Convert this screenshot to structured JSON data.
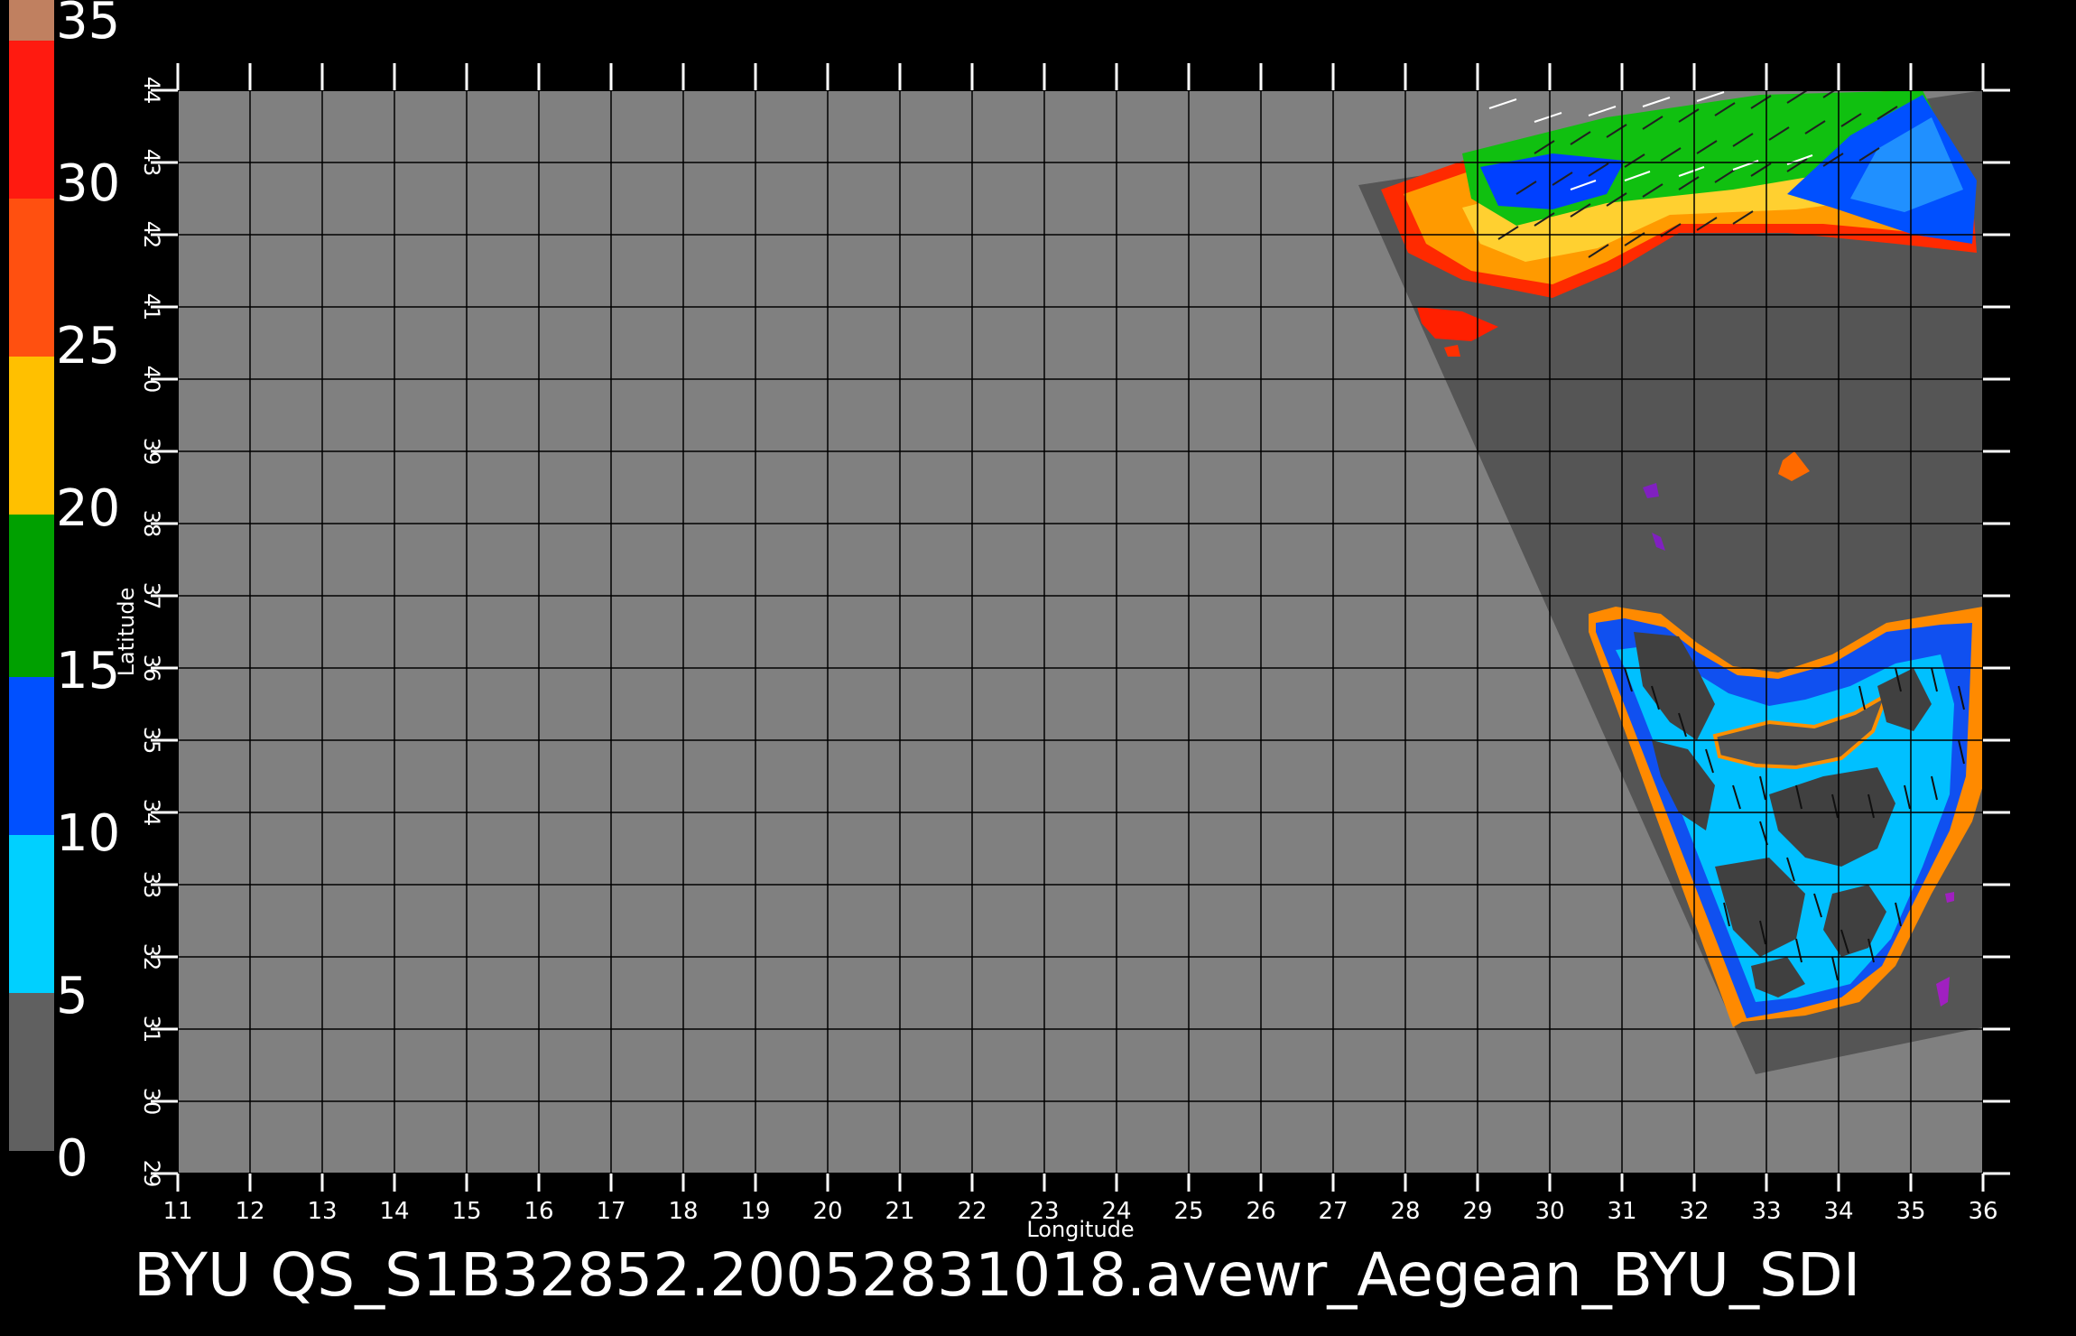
{
  "colorbar": {
    "labels": [
      "35",
      "30",
      "25",
      "20",
      "15",
      "10",
      "5",
      "0"
    ],
    "colors": {
      "top": "#c08060",
      "red": "#ff0000",
      "orange_red": "#ff3300",
      "orange": "#ff8000",
      "yellow_orange": "#ffc000",
      "yellow": "#ffff30",
      "green": "#00b000",
      "dark_green": "#006000",
      "blue": "#0030ff",
      "light_blue": "#00a0ff",
      "cyan": "#00f0ff",
      "dark_gray": "#303030",
      "gray": "#808080"
    }
  },
  "axes": {
    "x_label": "Longitude",
    "y_label": "Latitude",
    "x_ticks": [
      "11",
      "12",
      "13",
      "14",
      "15",
      "16",
      "17",
      "18",
      "19",
      "20",
      "21",
      "22",
      "23",
      "24",
      "25",
      "26",
      "27",
      "28",
      "29",
      "30",
      "31",
      "32",
      "33",
      "34",
      "35",
      "36"
    ],
    "y_ticks": [
      "44",
      "43",
      "42",
      "41",
      "40",
      "39",
      "38",
      "37",
      "36",
      "35",
      "34",
      "33",
      "32",
      "31",
      "30",
      "29"
    ],
    "lon_range": [
      11,
      36
    ],
    "lat_range": [
      29,
      44
    ],
    "grid": true
  },
  "map": {
    "background_color": "#808080",
    "swath_color": "#555555",
    "land_color": "#454545"
  },
  "caption": "BYU  QS_S1B32852.20052831018.avewr_Aegean_BYU_SDI"
}
